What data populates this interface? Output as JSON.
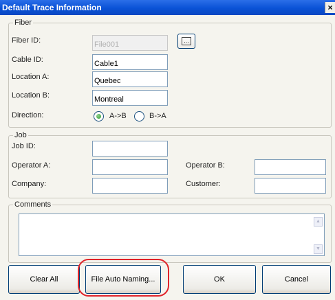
{
  "window": {
    "title": "Default Trace Information",
    "close_symbol": "×"
  },
  "fiber": {
    "legend": "Fiber",
    "fiber_id_label": "Fiber ID:",
    "fiber_id_value": "File001",
    "browse_label": "...",
    "cable_id_label": "Cable ID:",
    "cable_id_value": "Cable1",
    "location_a_label": "Location A:",
    "location_a_value": "Quebec",
    "location_b_label": "Location B:",
    "location_b_value": "Montreal",
    "direction_label": "Direction:",
    "direction_options": [
      "A->B",
      "B->A"
    ],
    "direction_selected": "A->B"
  },
  "job": {
    "legend": "Job",
    "job_id_label": "Job ID:",
    "job_id_value": "",
    "operator_a_label": "Operator A:",
    "operator_a_value": "",
    "operator_b_label": "Operator B:",
    "operator_b_value": "",
    "company_label": "Company:",
    "company_value": "",
    "customer_label": "Customer:",
    "customer_value": ""
  },
  "comments": {
    "legend": "Comments",
    "value": ""
  },
  "buttons": {
    "clear_all": "Clear All",
    "file_auto_naming": "File Auto Naming...",
    "ok": "OK",
    "cancel": "Cancel"
  },
  "colors": {
    "titlebar": "#0a52d6",
    "highlight": "#e0242a",
    "input_border": "#7f9db9"
  }
}
